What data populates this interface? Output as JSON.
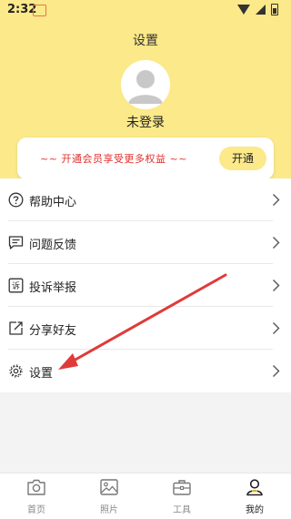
{
  "status_bar": {
    "time": "2:32"
  },
  "header": {
    "title": "设置",
    "login_status": "未登录",
    "background_color": "#fbe98a"
  },
  "vip_banner": {
    "text": "~~ 开通会员享受更多权益 ~~",
    "button_label": "开通",
    "text_color": "#e0302c"
  },
  "menu": {
    "items": [
      {
        "label": "帮助中心",
        "icon": "help-circle-icon"
      },
      {
        "label": "问题反馈",
        "icon": "feedback-icon"
      },
      {
        "label": "投诉举报",
        "icon": "complaint-icon"
      },
      {
        "label": "分享好友",
        "icon": "share-icon"
      },
      {
        "label": "设置",
        "icon": "settings-gear-icon"
      }
    ]
  },
  "tab_bar": {
    "tabs": [
      {
        "label": "首页",
        "icon": "camera-icon"
      },
      {
        "label": "照片",
        "icon": "image-icon"
      },
      {
        "label": "工具",
        "icon": "toolbox-icon"
      },
      {
        "label": "我的",
        "icon": "user-icon",
        "active": true
      }
    ]
  },
  "annotation": {
    "arrow_color": "#e03a3a",
    "points_to": "设置"
  }
}
